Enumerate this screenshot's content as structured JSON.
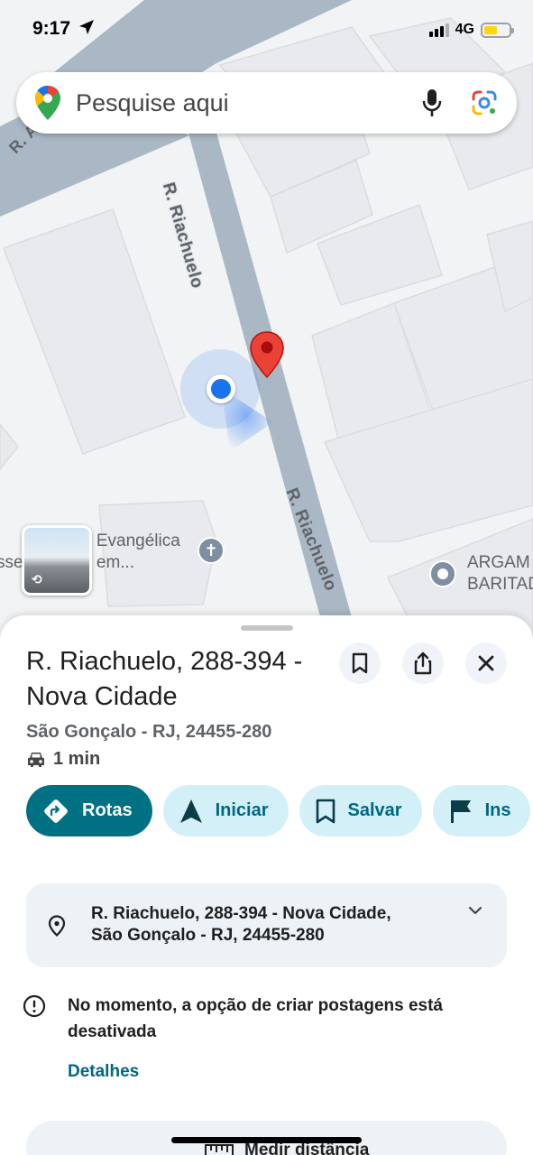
{
  "status_bar": {
    "time": "9:17",
    "network": "4G",
    "battery_level": 0.55,
    "signal_bars": 3
  },
  "search": {
    "placeholder": "Pesquise aqui"
  },
  "map": {
    "street_labels": [
      "R. Riachuelo",
      "R. Riachuelo",
      "R. A..."
    ],
    "poi_church_label_line1": "a Evangélica",
    "poi_church_label_line2": "sse   e Deus em...",
    "poi_arga_label_line1": "ARGAM",
    "poi_arga_label_line2": "BARITAD"
  },
  "place": {
    "title": "R. Riachuelo, 288-394 - Nova Cidade",
    "subtitle": "São Gonçalo - RJ, 24455-280",
    "travel_time": "1 min"
  },
  "actions": {
    "directions": "Rotas",
    "start": "Iniciar",
    "save": "Salvar",
    "label": "Ins"
  },
  "address_card": {
    "line1": "R. Riachuelo, 288-394 - Nova Cidade,",
    "line2": "São Gonçalo - RJ, 24455-280"
  },
  "notice": {
    "text": "No momento, a opção de criar postagens está desativada",
    "link": "Detalhes"
  },
  "measure": {
    "label": "Medir distância"
  },
  "colors": {
    "accent": "#007182",
    "chip_bg": "#d3f0f8",
    "road": "#aab7c4",
    "map_bg": "#f1f3f4",
    "pin_red": "#ea4335",
    "location_blue": "#1a73e8"
  }
}
